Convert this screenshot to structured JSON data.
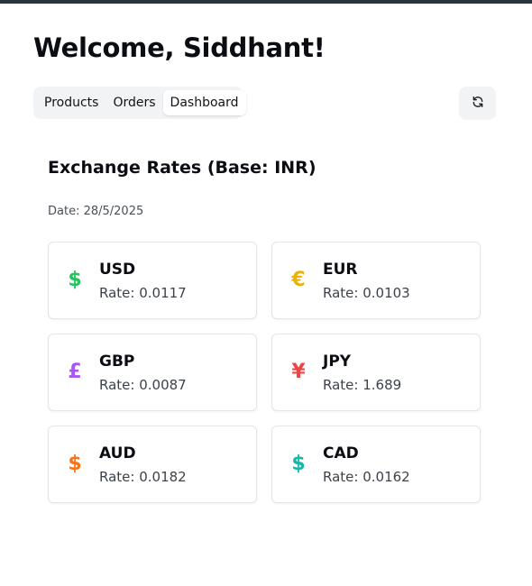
{
  "header": {
    "title": "Welcome, Siddhant!"
  },
  "tabs": [
    {
      "label": "Products",
      "active": false
    },
    {
      "label": "Orders",
      "active": false
    },
    {
      "label": "Dashboard",
      "active": true
    }
  ],
  "refresh_icon": "refresh-icon",
  "rates": {
    "title": "Exchange Rates (Base: INR)",
    "date": "Date: 28/5/2025",
    "items": [
      {
        "code": "USD",
        "rate": "Rate: 0.0117",
        "symbol": "$",
        "color": "#22c55e",
        "icon": "dollar-icon"
      },
      {
        "code": "EUR",
        "rate": "Rate: 0.0103",
        "symbol": "€",
        "color": "#eab308",
        "icon": "euro-icon"
      },
      {
        "code": "GBP",
        "rate": "Rate: 0.0087",
        "symbol": "£",
        "color": "#a855f7",
        "icon": "pound-icon"
      },
      {
        "code": "JPY",
        "rate": "Rate: 1.689",
        "symbol": "¥",
        "color": "#ef4444",
        "icon": "yen-icon"
      },
      {
        "code": "AUD",
        "rate": "Rate: 0.0182",
        "symbol": "$",
        "color": "#f97316",
        "icon": "dollar-icon"
      },
      {
        "code": "CAD",
        "rate": "Rate: 0.0162",
        "symbol": "$",
        "color": "#14b8a6",
        "icon": "dollar-icon"
      }
    ]
  }
}
